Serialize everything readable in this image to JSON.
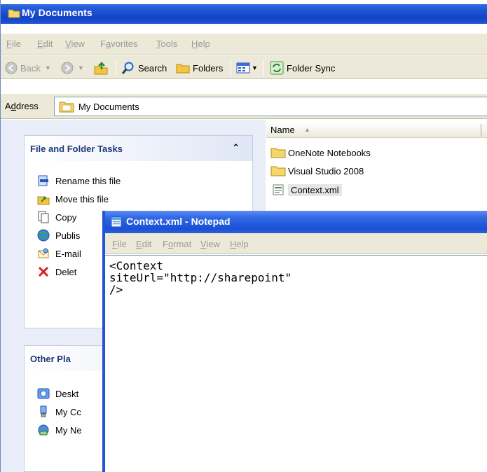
{
  "explorer": {
    "title": "My Documents",
    "menu": [
      {
        "label": "File",
        "u": "F"
      },
      {
        "label": "Edit",
        "u": "E"
      },
      {
        "label": "View",
        "u": "V"
      },
      {
        "label": "Favorites",
        "u": "a"
      },
      {
        "label": "Tools",
        "u": "T"
      },
      {
        "label": "Help",
        "u": "H"
      }
    ],
    "toolbar": {
      "back": "Back",
      "search": "Search",
      "folders": "Folders",
      "folder_sync": "Folder Sync"
    },
    "address": {
      "label": "Address",
      "value": "My Documents"
    },
    "file_tasks": {
      "title": "File and Folder Tasks",
      "items": [
        {
          "label": "Rename this file",
          "icon": "rename-icon"
        },
        {
          "label": "Move this file",
          "icon": "move-icon"
        },
        {
          "label": "Copy",
          "icon": "copy-icon"
        },
        {
          "label": "Publis",
          "icon": "publish-globe-icon"
        },
        {
          "label": "E-mail",
          "icon": "email-icon"
        },
        {
          "label": "Delet",
          "icon": "delete-icon"
        }
      ]
    },
    "other_places": {
      "title": "Other Pla",
      "items": [
        {
          "label": "Deskt",
          "icon": "desktop-icon"
        },
        {
          "label": "My Cc",
          "icon": "my-computer-icon"
        },
        {
          "label": "My Ne",
          "icon": "my-network-icon"
        }
      ]
    },
    "list": {
      "column_name": "Name",
      "items": [
        {
          "name": "OneNote Notebooks",
          "type": "folder"
        },
        {
          "name": "Visual Studio 2008",
          "type": "folder"
        },
        {
          "name": "Context.xml",
          "type": "xml",
          "selected": true
        }
      ]
    }
  },
  "notepad": {
    "title": "Context.xml - Notepad",
    "menu": [
      {
        "label": "File",
        "u": "F"
      },
      {
        "label": "Edit",
        "u": "E"
      },
      {
        "label": "Format",
        "u": "o"
      },
      {
        "label": "View",
        "u": "V"
      },
      {
        "label": "Help",
        "u": "H"
      }
    ],
    "content": "<Context\nsiteUrl=\"http://sharepoint\"\n/>"
  },
  "colors": {
    "titlebar": "#1d52d4",
    "chrome": "#ece9d8",
    "taskpane": "#e8edf8",
    "panel_title": "#1d3a7a"
  }
}
